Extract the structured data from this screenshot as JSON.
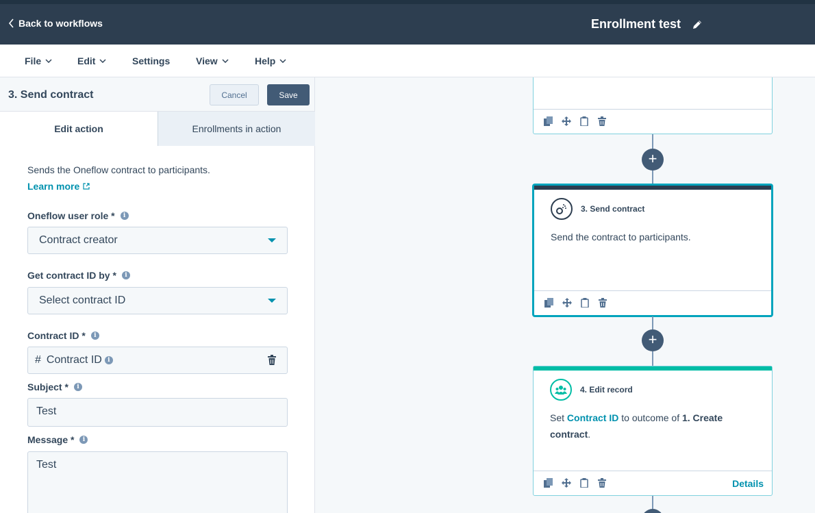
{
  "header": {
    "back_label": "Back to workflows",
    "workflow_title": "Enrollment test"
  },
  "menu": {
    "items": [
      {
        "label": "File",
        "has_dropdown": true
      },
      {
        "label": "Edit",
        "has_dropdown": true
      },
      {
        "label": "Settings",
        "has_dropdown": false
      },
      {
        "label": "View",
        "has_dropdown": true
      },
      {
        "label": "Help",
        "has_dropdown": true
      }
    ]
  },
  "panel": {
    "title": "3. Send contract",
    "cancel_label": "Cancel",
    "save_label": "Save",
    "tabs": [
      {
        "label": "Edit action",
        "active": true
      },
      {
        "label": "Enrollments in action",
        "active": false
      }
    ],
    "description": "Sends the Oneflow contract to participants.",
    "learn_more": "Learn more",
    "fields": {
      "user_role": {
        "label": "Oneflow user role *",
        "value": "Contract creator"
      },
      "get_contract_id_by": {
        "label": "Get contract ID by *",
        "value": "Select contract ID"
      },
      "contract_id": {
        "label": "Contract ID *",
        "token": "Contract ID"
      },
      "subject": {
        "label": "Subject *",
        "value": "Test"
      },
      "message": {
        "label": "Message *",
        "value": "Test"
      }
    }
  },
  "canvas": {
    "cards": [
      {
        "name": "3. Send contract",
        "text": "Send the contract to participants.",
        "selected": true,
        "accent_color": "#2d3e50"
      },
      {
        "name": "4. Edit record",
        "text_prefix": "Set",
        "text_token": "Contract ID",
        "text_middle": "to outcome of",
        "text_bold": "1. Create contract",
        "text_suffix": ".",
        "details_label": "Details",
        "accent_color": "#00bda5"
      }
    ]
  },
  "colors": {
    "header_bg": "#2d3e50",
    "link": "#0091ae",
    "selected_border": "#00a4bd",
    "teal_accent": "#00bda5"
  },
  "icons": [
    "chevron-left-icon",
    "pencil-icon",
    "chevron-down-icon",
    "external-link-icon",
    "info-icon",
    "dropdown-caret-icon",
    "hash-icon",
    "trash-icon",
    "clone-icon",
    "move-icon",
    "clipboard-icon",
    "plus-icon",
    "oneflow-logo-icon",
    "people-icon"
  ]
}
